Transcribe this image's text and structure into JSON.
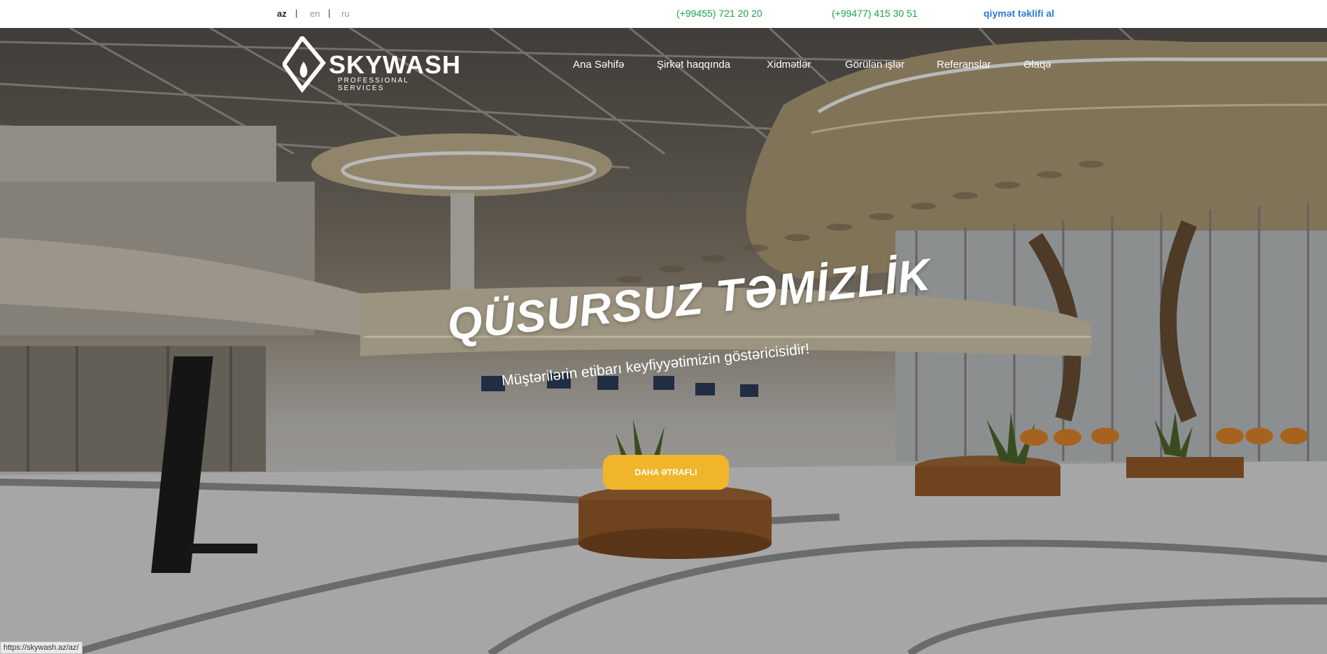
{
  "topbar": {
    "languages": [
      "az",
      "en",
      "ru"
    ],
    "active_language": "az",
    "separator": "|",
    "phones": [
      "(+99455) 721 20 20",
      "(+99477) 415 30 51"
    ],
    "quote_link": "qiymət təklifi al"
  },
  "brand": {
    "name": "SKYWASH",
    "tagline": "PROFESSIONAL SERVICES"
  },
  "nav": {
    "items": [
      "Ana Səhifə",
      "Şirkət haqqında",
      "Xidmətlər",
      "Görülən işlər",
      "Referanslar",
      "Əlaqə"
    ]
  },
  "hero": {
    "title": "QÜSURSUZ TƏMİZLİK",
    "subtitle": "Müştərilərin etibarı keyfiyyətimizin göstəricisidir!",
    "cta": "DAHA ƏTRAFLI"
  },
  "status_bar": {
    "url": "https://skywash.az/az/"
  },
  "colors": {
    "phone": "#1aa34a",
    "quote_link": "#2b7bd3",
    "cta": "#f0b52a"
  }
}
